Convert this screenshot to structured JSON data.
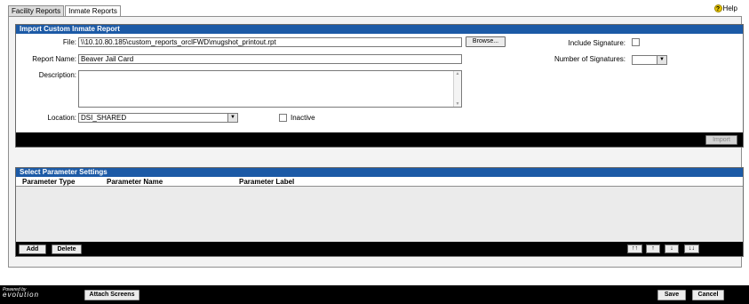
{
  "tabs": [
    {
      "label": "Facility Reports",
      "active": false
    },
    {
      "label": "Inmate Reports",
      "active": true
    }
  ],
  "help_label": "Help",
  "import_panel": {
    "title": "Import Custom Inmate Report",
    "file_label": "File:",
    "file_value": "\\\\10.10.80.185\\custom_reports_orclFWD\\mugshot_printout.rpt",
    "browse_label": "Browse...",
    "report_name_label": "Report Name:",
    "report_name_value": "Beaver Jail Card",
    "description_label": "Description:",
    "description_value": "",
    "location_label": "Location:",
    "location_value": "DSI_SHARED",
    "inactive_label": "Inactive",
    "include_signature_label": "Include Signature:",
    "number_of_signatures_label": "Number of Signatures:",
    "number_of_signatures_value": "",
    "import_label": "Import"
  },
  "param_panel": {
    "title": "Select Parameter Settings",
    "columns": [
      "Parameter Type",
      "Parameter Name",
      "Parameter Label"
    ],
    "rows": [],
    "add_label": "Add",
    "delete_label": "Delete",
    "move_buttons": [
      "↑↑",
      "↑",
      "↓",
      "↓↓"
    ]
  },
  "footer": {
    "logo_top": "Powered by",
    "logo_bottom": "evolution",
    "attach_label": "Attach Screens",
    "save_label": "Save",
    "cancel_label": "Cancel"
  },
  "colors": {
    "panel_header": "#1c5aa6",
    "bar": "#000000"
  }
}
